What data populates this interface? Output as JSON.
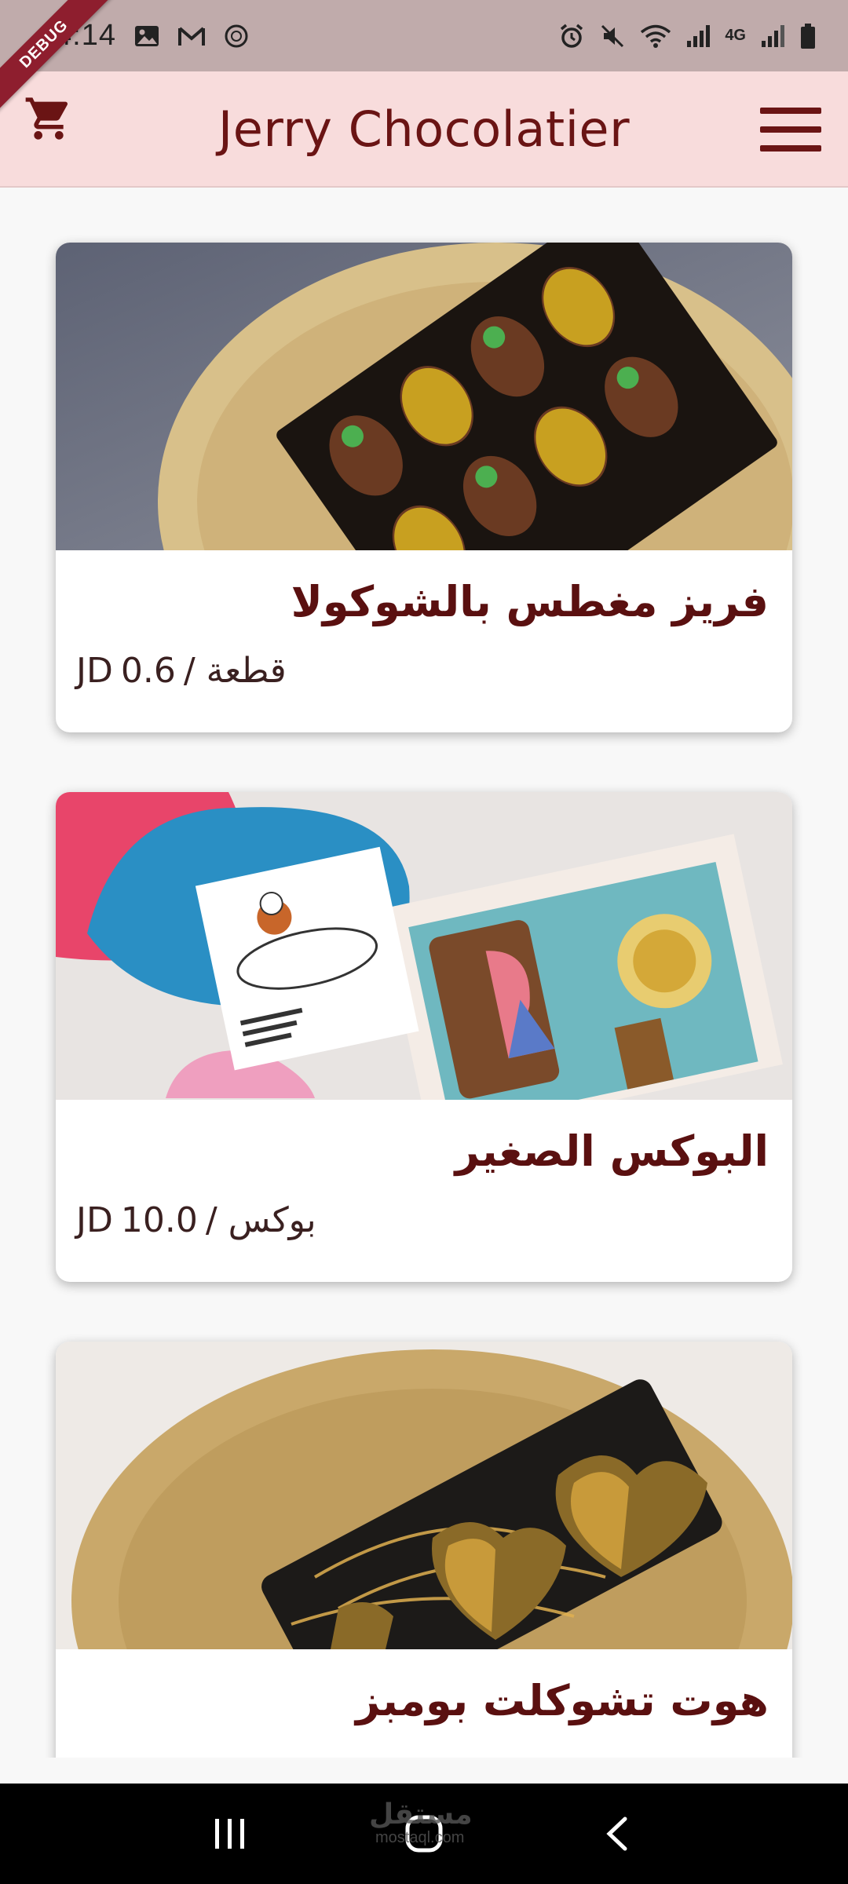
{
  "status_bar": {
    "time": "4:14",
    "debug_label": "DEBUG",
    "network_label": "4G",
    "colors": {
      "background": "#c0abab"
    }
  },
  "app_bar": {
    "title": "Jerry Chocolatier",
    "cart_icon": "shopping-cart-icon",
    "menu_icon": "hamburger-menu-icon",
    "colors": {
      "background": "#f8dcdc",
      "title": "#6a1414"
    }
  },
  "products": [
    {
      "name": "فريز مغطس بالشوكولا",
      "currency": "JD",
      "price": "0.6",
      "unit": "/ قطعة",
      "image": "chocolate-strawberries-box"
    },
    {
      "name": "البوكس الصغير",
      "currency": "JD",
      "price": "10.0",
      "unit": "/ بوكس",
      "image": "small-chocolate-box"
    },
    {
      "name": "هوت تشوكلت بومبز",
      "image": "hot-chocolate-bombs"
    }
  ],
  "nav_bar": {
    "recent_icon": "recent-apps-icon",
    "home_icon": "home-icon",
    "back_icon": "back-icon",
    "watermark": "مستقل",
    "watermark_sub": "mostaql.com"
  }
}
